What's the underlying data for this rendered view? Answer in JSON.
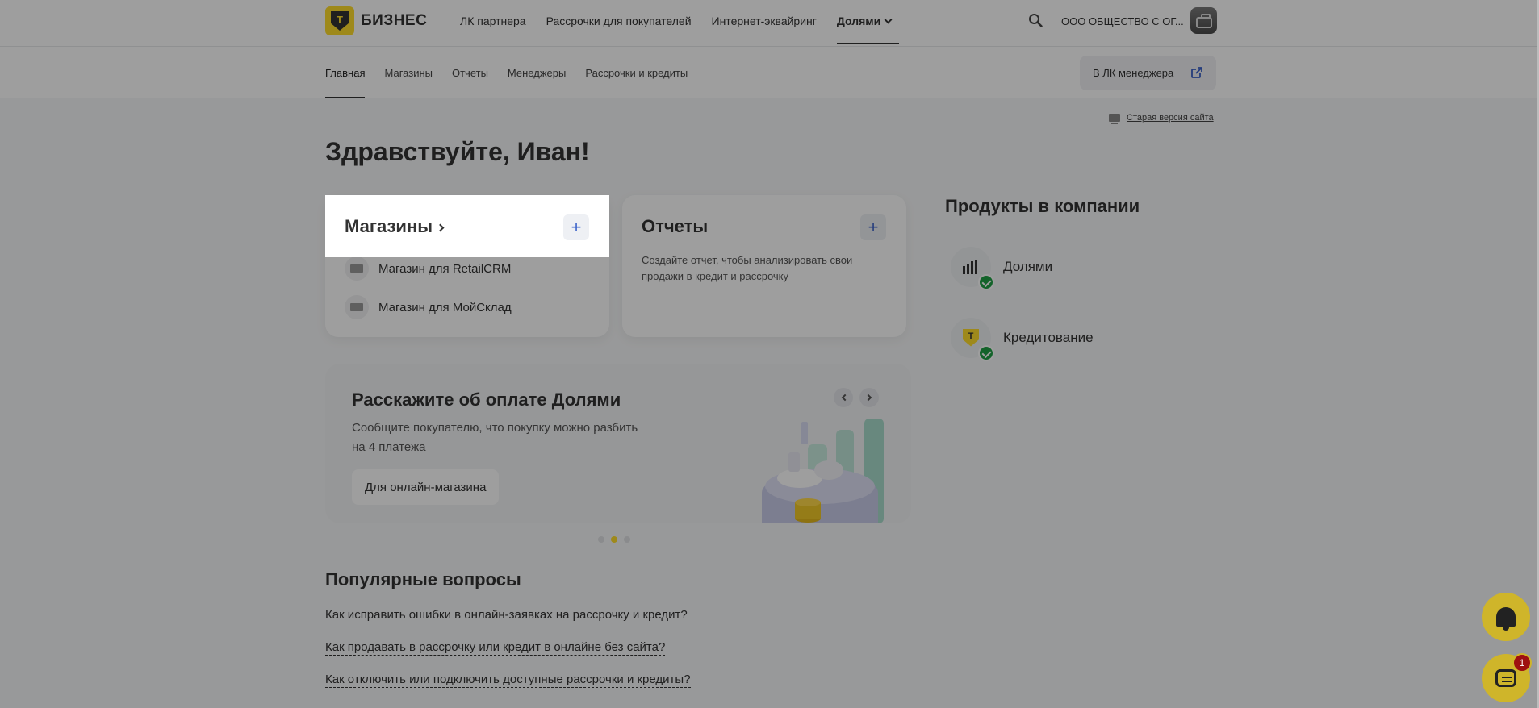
{
  "header": {
    "logo_text": "БИЗНЕС",
    "logo_letter": "Т",
    "nav": [
      "ЛК партнера",
      "Рассрочки для покупателей",
      "Интернет-эквайринг"
    ],
    "nav_active": "Долями",
    "company": "ООО ОБЩЕСТВО С ОГ..."
  },
  "tabs": {
    "items": [
      "Главная",
      "Магазины",
      "Отчеты",
      "Менеджеры",
      "Рассрочки и кредиты"
    ],
    "manager_button": "В ЛК менеджера"
  },
  "old_site": "Старая версия сайта",
  "greeting": "Здравствуйте, Иван!",
  "stores_card": {
    "title": "Магазины",
    "plus": "+",
    "items": [
      "Магазин для RetailCRM",
      "Магазин для МойСклад"
    ]
  },
  "reports_card": {
    "title": "Отчеты",
    "plus": "+",
    "description": "Создайте отчет, чтобы анализировать свои продажи в кредит и рассрочку"
  },
  "banner": {
    "title": "Расскажите об оплате Долями",
    "text": "Сообщите покупателю, что покупку можно разбить на 4 платежа",
    "button": "Для онлайн-магазина",
    "slides": 3,
    "active_slide": 2
  },
  "products": {
    "title": "Продукты в компании",
    "items": [
      {
        "label": "Долями",
        "icon": "dolyami-bars-icon",
        "status": "connected"
      },
      {
        "label": "Кредитование",
        "icon": "t-shield-icon",
        "status": "connected"
      }
    ]
  },
  "faq": {
    "title": "Популярные вопросы",
    "items": [
      "Как исправить ошибки в онлайн-заявках на рассрочку и кредит?",
      "Как продавать в рассрочку или кредит в онлайне без сайта?",
      "Как отключить или подключить доступные рассрочки и кредиты?"
    ]
  },
  "chat_badge": "1",
  "colors": {
    "accent_yellow": "#ffdd2d",
    "link_blue": "#3b62c9",
    "success_green": "#1fa045",
    "badge_red": "#9e1010"
  }
}
